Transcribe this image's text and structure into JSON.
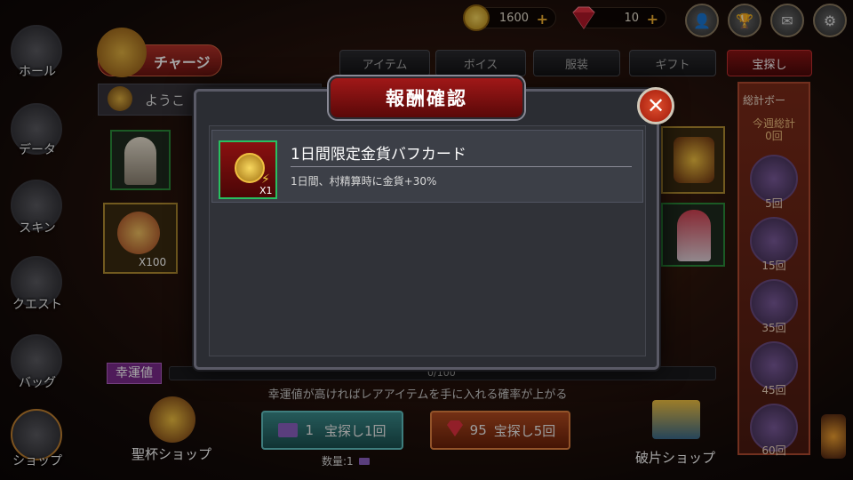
{
  "top_bar": {
    "gold_amount": "1600",
    "gem_amount": "10"
  },
  "side_menu": [
    {
      "label": "ホール",
      "icon": "hall-icon"
    },
    {
      "label": "データ",
      "icon": "data-icon"
    },
    {
      "label": "スキン",
      "icon": "skin-icon"
    },
    {
      "label": "クエスト",
      "icon": "quest-icon"
    },
    {
      "label": "バッグ",
      "icon": "bag-icon"
    },
    {
      "label": "ショップ",
      "icon": "shop-icon"
    }
  ],
  "charge_label": "チャージ",
  "welcome_text": "ようこ",
  "tabs": [
    {
      "label": "アイテム",
      "active": false
    },
    {
      "label": "ボイス",
      "active": false
    },
    {
      "label": "服装",
      "active": false
    },
    {
      "label": "ギフト",
      "active": false
    },
    {
      "label": "宝探し",
      "active": true
    }
  ],
  "left_cards": {
    "qty_label": "X100"
  },
  "right_panel": {
    "title": "総計ボー",
    "week_label": "今週総計",
    "week_count": "0回",
    "milestones": [
      "5回",
      "15回",
      "35回",
      "45回",
      "60回"
    ]
  },
  "luck": {
    "label": "幸運値",
    "progress_text": "0/100",
    "hint": "幸運値が高ければレアアイテムを手に入れる確率が上がる"
  },
  "bottom": {
    "left_shop": "聖杯ショップ",
    "right_shop": "破片ショップ",
    "hunt1_cost": "1",
    "hunt1_label": "宝探し1回",
    "hunt5_cost": "95",
    "hunt5_label": "宝探し5回",
    "qty_text": "数量:1"
  },
  "modal": {
    "title": "報酬確認",
    "item_name": "1日間限定金貨バフカード",
    "item_desc": "1日間、村精算時に金貨+30%",
    "item_qty": "X1"
  }
}
